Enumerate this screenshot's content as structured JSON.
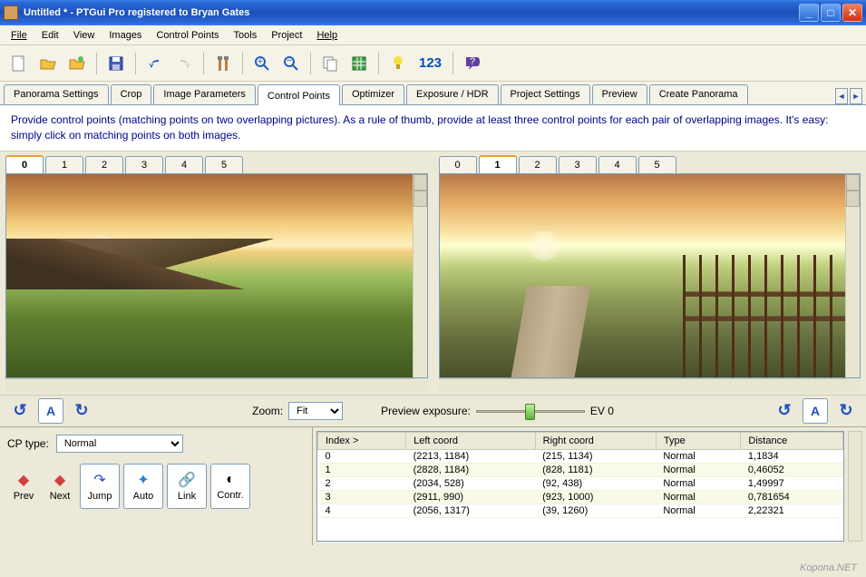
{
  "window": {
    "title": "Untitled * - PTGui Pro registered to Bryan Gates"
  },
  "menu": [
    "File",
    "Edit",
    "View",
    "Images",
    "Control Points",
    "Tools",
    "Project",
    "Help"
  ],
  "toolbar": {
    "icons": [
      "new-doc",
      "open-folder",
      "open-project",
      "save",
      "undo",
      "redo",
      "tools",
      "zoom-in",
      "zoom-out",
      "copy",
      "grid",
      "bulb",
      "numbers",
      "help"
    ],
    "numbers_label": "123"
  },
  "tabs": {
    "items": [
      "Panorama Settings",
      "Crop",
      "Image Parameters",
      "Control Points",
      "Optimizer",
      "Exposure / HDR",
      "Project Settings",
      "Preview",
      "Create Panorama"
    ],
    "active": 3
  },
  "instruction": "Provide control points (matching points on two overlapping pictures). As a rule of thumb, provide at least three control points for each pair of overlapping images. It's easy: simply click on matching points on both images.",
  "left_pane": {
    "tabs": [
      "0",
      "1",
      "2",
      "3",
      "4",
      "5"
    ],
    "active": 0
  },
  "right_pane": {
    "tabs": [
      "0",
      "1",
      "2",
      "3",
      "4",
      "5"
    ],
    "active": 1
  },
  "controls": {
    "zoom_label": "Zoom:",
    "zoom_value": "Fit",
    "preview_label": "Preview exposure:",
    "ev_label": "EV 0",
    "a_label": "A"
  },
  "bottom": {
    "cp_type_label": "CP type:",
    "cp_type_value": "Normal",
    "prev": "Prev",
    "next": "Next",
    "jump": "Jump",
    "auto": "Auto",
    "link": "Link",
    "contr": "Contr."
  },
  "table": {
    "headers": [
      "Index >",
      "Left coord",
      "Right coord",
      "Type",
      "Distance"
    ],
    "rows": [
      {
        "idx": "0",
        "left": "(2213, 1184)",
        "right": "(215, 1134)",
        "type": "Normal",
        "dist": "1,1834"
      },
      {
        "idx": "1",
        "left": "(2828, 1184)",
        "right": "(828, 1181)",
        "type": "Normal",
        "dist": "0,46052"
      },
      {
        "idx": "2",
        "left": "(2034, 528)",
        "right": "(92, 438)",
        "type": "Normal",
        "dist": "1,49997"
      },
      {
        "idx": "3",
        "left": "(2911, 990)",
        "right": "(923, 1000)",
        "type": "Normal",
        "dist": "0,781654"
      },
      {
        "idx": "4",
        "left": "(2056, 1317)",
        "right": "(39, 1260)",
        "type": "Normal",
        "dist": "2,22321"
      }
    ]
  },
  "watermark": "Kopona.NET"
}
